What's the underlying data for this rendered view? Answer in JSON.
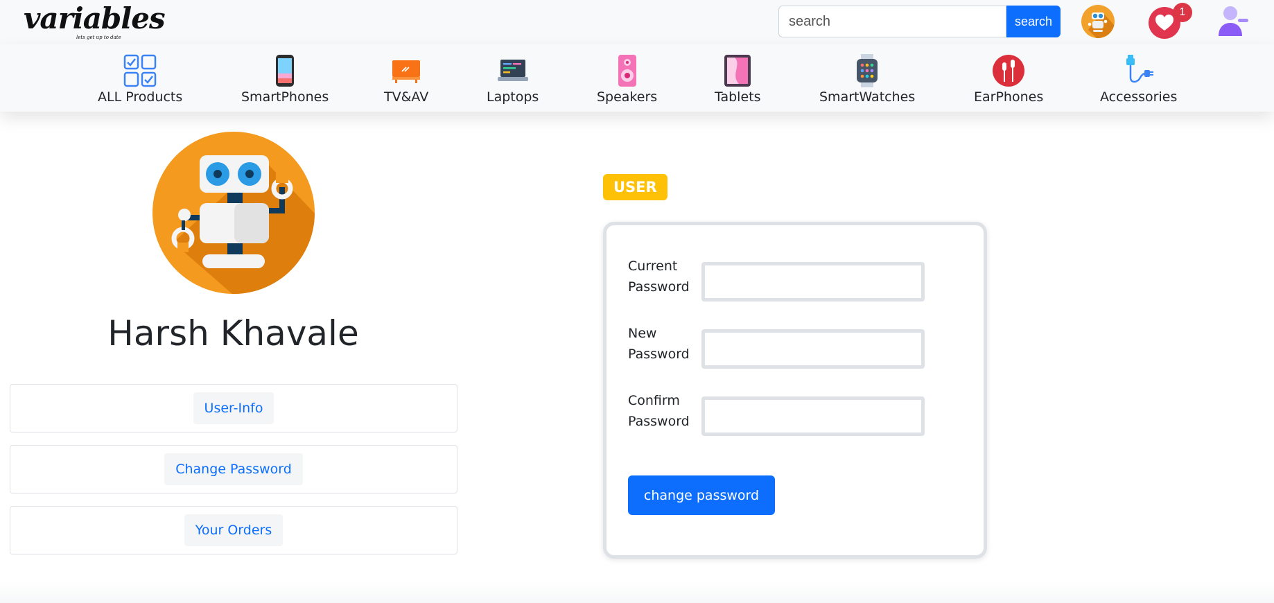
{
  "brand": {
    "name": "variables",
    "tagline": "lets get up to date"
  },
  "header": {
    "search_placeholder": "search",
    "search_button": "search",
    "wishlist_count": "1"
  },
  "categories": [
    {
      "label": "ALL Products",
      "icon": "grid-checklist-icon"
    },
    {
      "label": "SmartPhones",
      "icon": "smartphone-icon"
    },
    {
      "label": "TV&AV",
      "icon": "tv-icon"
    },
    {
      "label": "Laptops",
      "icon": "laptop-icon"
    },
    {
      "label": "Speakers",
      "icon": "speaker-icon"
    },
    {
      "label": "Tablets",
      "icon": "tablet-icon"
    },
    {
      "label": "SmartWatches",
      "icon": "smartwatch-icon"
    },
    {
      "label": "EarPhones",
      "icon": "earphones-icon"
    },
    {
      "label": "Accessories",
      "icon": "charger-cable-icon"
    }
  ],
  "profile": {
    "name": "Harsh Khavale",
    "menu": [
      "User-Info",
      "Change Password",
      "Your Orders"
    ]
  },
  "form": {
    "role_badge": "USER",
    "fields": [
      {
        "label_line1": "Current",
        "label_line2": "Password",
        "value": ""
      },
      {
        "label_line1": "New",
        "label_line2": "Password",
        "value": ""
      },
      {
        "label_line1": "Confirm",
        "label_line2": "Password",
        "value": ""
      }
    ],
    "submit_label": "change password"
  },
  "colors": {
    "primary": "#0d6efd",
    "warning": "#ffc107",
    "danger": "#dc3545",
    "avatar_orange": "#f39a1f"
  }
}
